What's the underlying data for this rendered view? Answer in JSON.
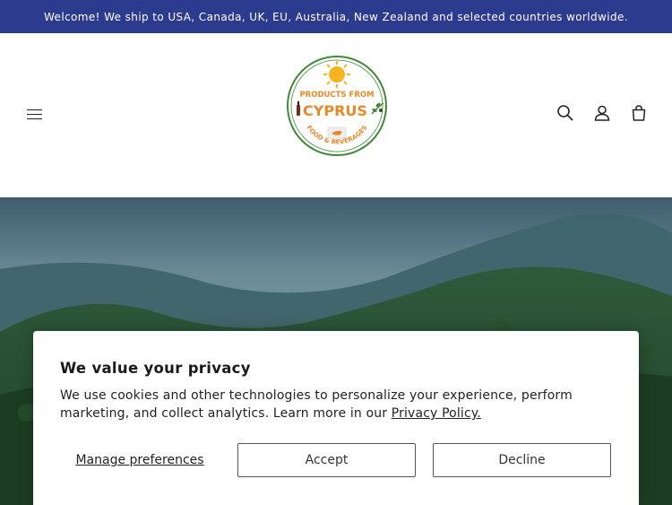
{
  "announcement": {
    "text": "Welcome! We ship to USA, Canada, UK, EU, Australia, New Zealand and selected countries worldwide."
  },
  "header": {
    "logo": {
      "line1": "PRODUCTS FROM",
      "line2": "CYPRUS",
      "line3": "FOOD & BEVERAGES"
    },
    "icons": [
      "menu-icon",
      "search-icon",
      "account-icon",
      "cart-icon"
    ]
  },
  "cookie_banner": {
    "title": "We value your privacy",
    "body": "We use cookies and other technologies to personalize your experience, perform marketing, and collect analytics. Learn more in our ",
    "link": "Privacy Policy.",
    "manage_label": "Manage preferences",
    "accept_label": "Accept",
    "decline_label": "Decline"
  },
  "colors": {
    "announcement_bg": "#2d3b8f",
    "logo_green": "#3f8a3a",
    "logo_orange": "#e8892a"
  }
}
